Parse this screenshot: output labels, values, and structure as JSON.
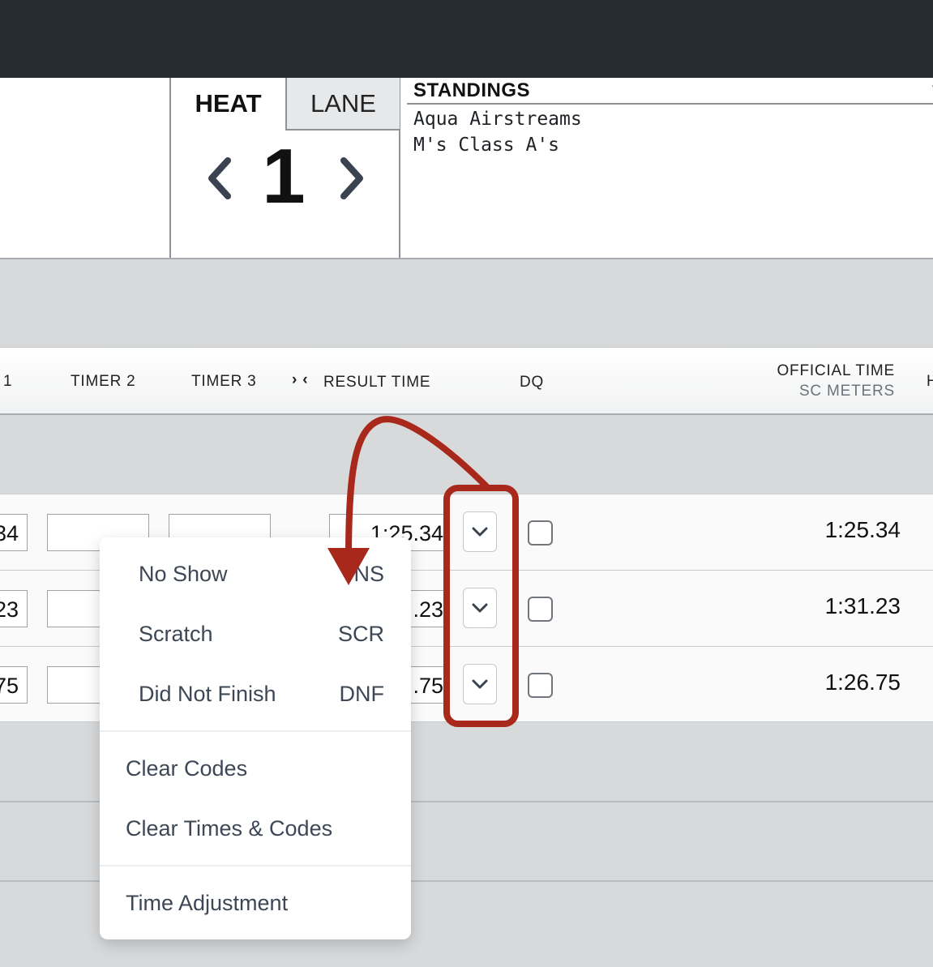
{
  "header": {
    "tabs": {
      "heat": "HEAT",
      "lane": "LANE"
    },
    "heat_number": "1",
    "standings": {
      "title": "STANDINGS",
      "teams": [
        "Aqua Airstreams",
        "M's Class A's"
      ]
    }
  },
  "columns": {
    "timer1": "1",
    "timer2": "TIMER 2",
    "timer3": "TIMER 3",
    "result_icon": "› ‹",
    "result": "RESULT TIME",
    "dq": "DQ",
    "official": "OFFICIAL TIME",
    "official_unit": "SC METERS",
    "edge": "H"
  },
  "rows": [
    {
      "timer1": "34",
      "result": "1:25.34",
      "official": "1:25.34"
    },
    {
      "timer1": "23",
      "result": ".23",
      "official": "1:31.23"
    },
    {
      "timer1": "75",
      "result": ".75",
      "official": "1:26.75"
    }
  ],
  "menu": {
    "codes": [
      {
        "label": "No Show",
        "code": "NS"
      },
      {
        "label": "Scratch",
        "code": "SCR"
      },
      {
        "label": "Did Not Finish",
        "code": "DNF"
      }
    ],
    "clear_codes": "Clear Codes",
    "clear_times_codes": "Clear Times & Codes",
    "time_adjustment": "Time Adjustment"
  },
  "annotation": {
    "color": "#a8281c"
  },
  "colors": {
    "topbar": "#262a31",
    "background": "#d7d9db"
  }
}
